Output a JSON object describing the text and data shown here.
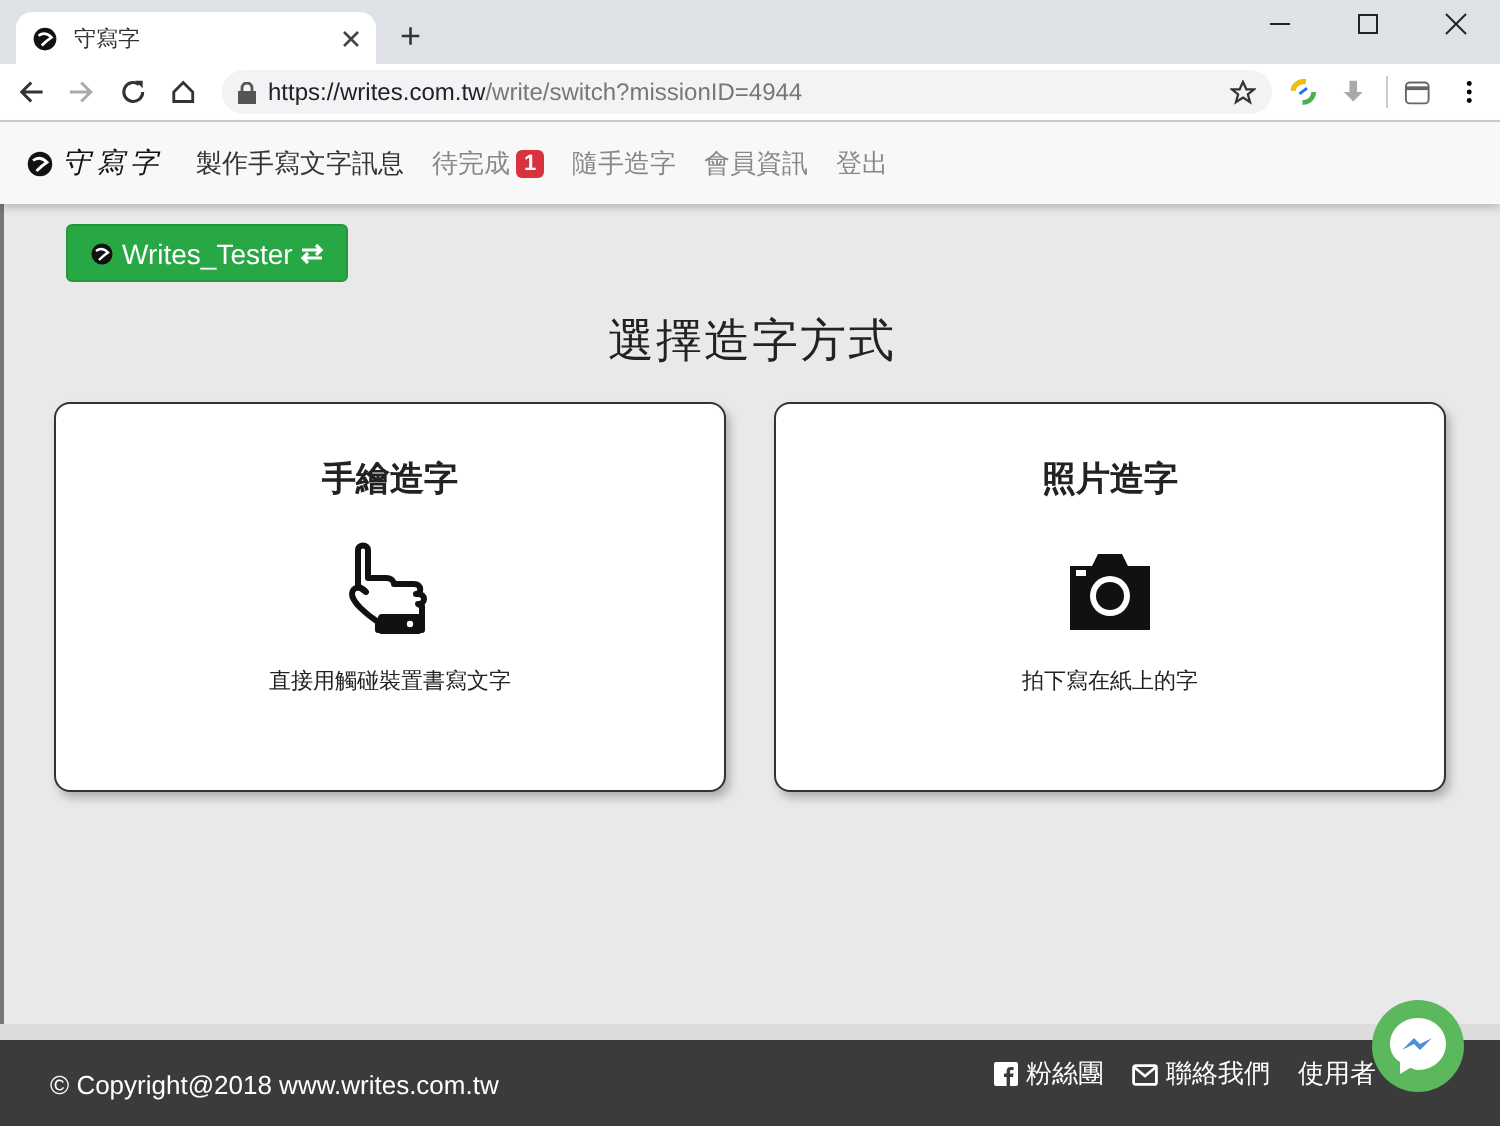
{
  "browser": {
    "tab_title": "守寫字",
    "new_tab": "+",
    "url_host": "https://writes.com.tw",
    "url_path": "/write/switch?missionID=4944"
  },
  "nav": {
    "brand": "守寫字",
    "items": [
      {
        "label": "製作手寫文字訊息",
        "selected": true
      },
      {
        "label": "待完成",
        "selected": false,
        "badge": "1"
      },
      {
        "label": "隨手造字",
        "selected": false
      },
      {
        "label": "會員資訊",
        "selected": false
      },
      {
        "label": "登出",
        "selected": false
      }
    ]
  },
  "user_button": {
    "label": "Writes_Tester"
  },
  "heading": "選擇造字方式",
  "cards": [
    {
      "kind": "hand",
      "title": "手繪造字",
      "caption": "直接用觸碰裝置書寫文字"
    },
    {
      "kind": "camera",
      "title": "照片造字",
      "caption": "拍下寫在紙上的字"
    }
  ],
  "footer": {
    "copyright": "© Copyright@2018 www.writes.com.tw",
    "links": [
      {
        "kind": "facebook",
        "label": "粉絲團"
      },
      {
        "kind": "mail",
        "label": "聯絡我們"
      },
      {
        "kind": "plain",
        "label": "使用者"
      }
    ]
  }
}
